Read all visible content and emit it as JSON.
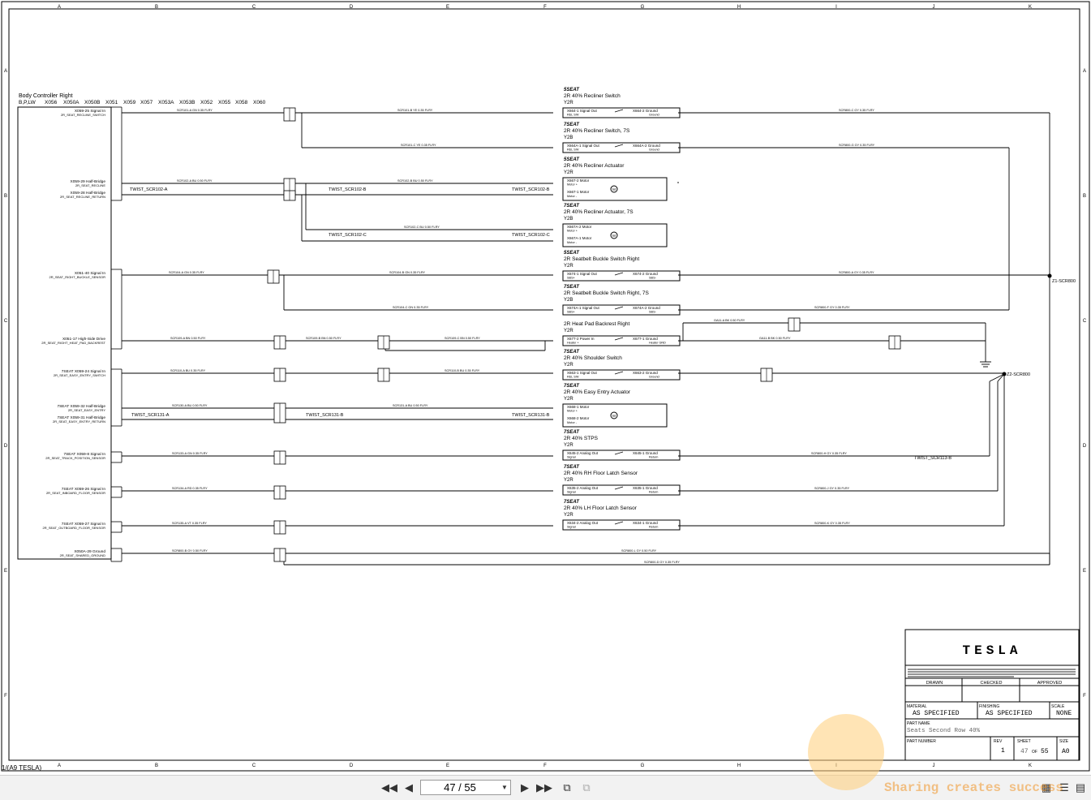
{
  "grid": {
    "columns": [
      "A",
      "B",
      "C",
      "D",
      "E",
      "F",
      "G",
      "H",
      "I",
      "J",
      "K"
    ],
    "rows": [
      "A",
      "B",
      "C",
      "D",
      "E",
      "F"
    ]
  },
  "controller": {
    "title": "Body Controller Right",
    "variants": "B,P,LW",
    "connectors": [
      "X056",
      "X050A",
      "X050B",
      "X051",
      "X059",
      "X057",
      "X053A",
      "X053B",
      "X052",
      "X055",
      "X058",
      "X060"
    ]
  },
  "left_pins": [
    {
      "l1": "X059-25 Signal In",
      "l2": "2R_SEAT_RECLINE_SWITCH"
    },
    {
      "l1": "X059-29 Half-Bridge",
      "l2": "2R_SEAT_RECLINE"
    },
    {
      "l1": "X059-28 Half-Bridge",
      "l2": "2R_SEAT_RECLINE_RETURN"
    },
    {
      "l1": "X051-40 Signal In",
      "l2": "2R_SEAT_RIGHT_BUCKLE_SENSOR"
    },
    {
      "l1": "X051-17 High-Side Drive",
      "l2": "2R_SEAT_RIGHT_HEAT_PAD_BACKREST"
    },
    {
      "l1": "7SEAT X059-24 Signal In",
      "l2": "2R_SEAT_EASY_ENTRY_SWITCH"
    },
    {
      "l1": "7SEAT X059-32 Half-Bridge",
      "l2": "2R_SEAT_EASY_ENTRY"
    },
    {
      "l1": "7SEAT X059-31 Half-Bridge",
      "l2": "2R_SEAT_EASY_ENTRY_RETURN"
    },
    {
      "l1": "7SEAT X059-8 Signal In",
      "l2": "2R_SEAT_TRACK_POSITION_SENSOR"
    },
    {
      "l1": "7SEAT X059-26 Signal In",
      "l2": "2R_SEAT_INBOARD_FLOOR_SENSOR"
    },
    {
      "l1": "7SEAT X059-27 Signal In",
      "l2": "2R_SEAT_OUTBOARD_FLOOR_SENSOR"
    },
    {
      "l1": "X050A-29 Ground",
      "l2": "2R_SEAT_SHARED_GROUND"
    }
  ],
  "twists": {
    "a": "TWIST_SCR102-A",
    "b": "TWIST_SCR102-B",
    "c": "TWIST_SCR102-C",
    "e_a": "TWIST_SCR131-A",
    "e_b": "TWIST_SCR131-B",
    "floor": "TWIST_SCR113-B"
  },
  "components": [
    {
      "variant": "5SEAT",
      "name": "2R 40% Recliner Switch",
      "loc": "Y2R",
      "pin1": "X664-1 Signal Out",
      "sub1": "REL SW",
      "pin2": "X664-2 Ground",
      "sub2": "Ground"
    },
    {
      "variant": "7SEAT",
      "name": "2R 40% Recliner Switch, 7S",
      "loc": "Y2B",
      "pin1": "X664A-1 Signal Out",
      "sub1": "REL SW",
      "pin2": "X664A-2 Ground",
      "sub2": "Ground"
    },
    {
      "variant": "5SEAT",
      "name": "2R 40% Recliner Actuator",
      "loc": "Y2R",
      "pin1": "X667-2 Motor",
      "sub1": "Motor +",
      "pin2": "X667-1 Motor",
      "sub2": "Motor -"
    },
    {
      "variant": "7SEAT",
      "name": "2R 40% Recliner Actuator, 7S",
      "loc": "Y2B",
      "pin1": "X667A-2 Motor",
      "sub1": "Motor +",
      "pin2": "X667A-1 Motor",
      "sub2": "Motor -"
    },
    {
      "variant": "5SEAT",
      "name": "2R Seatbelt Buckle Switch Right",
      "loc": "Y2R",
      "pin1": "X674-1 Signal Out",
      "sub1": "SBS+",
      "pin2": "X674-2 Ground",
      "sub2": "SBS-"
    },
    {
      "variant": "7SEAT",
      "name": "2R Seatbelt Buckle Switch Right, 7S",
      "loc": "Y2B",
      "pin1": "X674A-1 Signal Out",
      "sub1": "SBS+",
      "pin2": "X674A-2 Ground",
      "sub2": "SBS-"
    },
    {
      "variant": "",
      "name": "2R Heat Pad Backrest Right",
      "loc": "Y2R",
      "pin1": "X677-2 Power In",
      "sub1": "Heater +",
      "pin2": "X677-1 Ground",
      "sub2": "Heater GND"
    },
    {
      "variant": "7SEAT",
      "name": "2R 40% Shoulder Switch",
      "loc": "Y2R",
      "pin1": "X663-1 Signal Out",
      "sub1": "REL SW",
      "pin2": "X663-2 Ground",
      "sub2": "Ground"
    },
    {
      "variant": "7SEAT",
      "name": "2R 40% Easy Entry Actuator",
      "loc": "Y2R",
      "pin1": "X668-1 Motor",
      "sub1": "Motor +",
      "pin2": "X668-2 Motor",
      "sub2": "Motor -"
    },
    {
      "variant": "7SEAT",
      "name": "2R 40% STPS",
      "loc": "Y2R",
      "pin1": "X645-2 Analog Out",
      "sub1": "Signal",
      "pin2": "X645-1 Ground",
      "sub2": "Return"
    },
    {
      "variant": "7SEAT",
      "name": "2R 40% RH Floor Latch Sensor",
      "loc": "Y2R",
      "pin1": "X635-2 Analog Out",
      "sub1": "Signal",
      "pin2": "X635-1 Ground",
      "sub2": "Return"
    },
    {
      "variant": "7SEAT",
      "name": "2R 40% LH Floor Latch Sensor",
      "loc": "Y2R",
      "pin1": "X634-2 Analog Out",
      "sub1": "Signal",
      "pin2": "X634-1 Ground",
      "sub2": "Return"
    }
  ],
  "splices": {
    "top": "Z1-SCR800",
    "bottom": "Z2-SCR800"
  },
  "wire_labels": [
    "SCR101-A GN 0.35 FLRY",
    "SCR101-B YE 0.35 FLRY",
    "SCR101-C YE 0.35 FLRY",
    "SCR800-C GY 0.35 FLRY",
    "SCR800-G GY 0.35 FLRY",
    "SCR102-A BU 0.50 FLRY",
    "SCR102-B BU 0.50 FLRY",
    "SCR102-C BU 0.50 FLRY",
    "SCR104-A GN 0.35 FLRY",
    "SCR104-B GN 0.35 FLRY",
    "SCR104-C GN 0.35 FLRY",
    "SCR800-A GY 0.35 FLRY",
    "SCR800-F GY 0.35 FLRY",
    "SCR109-A BN 0.50 FLRY",
    "SCR109-B BN 0.50 FLRY",
    "SCR109-C BN 0.50 FLRY",
    "GA11-A BK 0.50 FLRY",
    "GA11-B BK 0.50 FLRY",
    "SCR110-A BU 0.35 FLRY",
    "SCR110-B BU 0.35 FLRY",
    "SCR130-A BU 0.50 FLRY",
    "SCR131-A BU 0.50 FLRY",
    "SCR133-A GN 0.35 FLRY",
    "SCR134-A RD 0.35 FLRY",
    "SCR135-A VT 0.35 FLRY",
    "SCR800-B GY 0.50 FLRY",
    "SCR800-L GY 0.50 FLRY",
    "SCR800-H GY 0.35 FLRY",
    "SCR800-J GY 0.35 FLRY",
    "SCR800-K GY 0.35 FLRY",
    "SCR800-D GY 0.35 FLRY"
  ],
  "title_block": {
    "logo": "TESLA",
    "drawn_label": "DRAWN",
    "checked_label": "CHECKED",
    "approved_label": "APPROVED",
    "material_label": "MATERIAL",
    "material_value": "AS SPECIFIED",
    "finishing_label": "FINISHING",
    "finishing_value": "AS SPECIFIED",
    "scale_label": "SCALE",
    "scale_value": "NONE",
    "part_name_label": "PART NAME",
    "part_name_value": "Seats Second Row 40%",
    "part_number_label": "PART NUMBER",
    "rev_label": "REV",
    "rev_value": "1",
    "sheet_label": "SHEET",
    "sheet_value": "47",
    "of_label": "OF",
    "sheet_total": "55",
    "size_label": "SIZE",
    "size_value": "A0"
  },
  "sheet_footer": "1/(A9 TESLA)",
  "toolbar": {
    "page_display": "47 / 55"
  },
  "watermark": "Sharing creates success"
}
